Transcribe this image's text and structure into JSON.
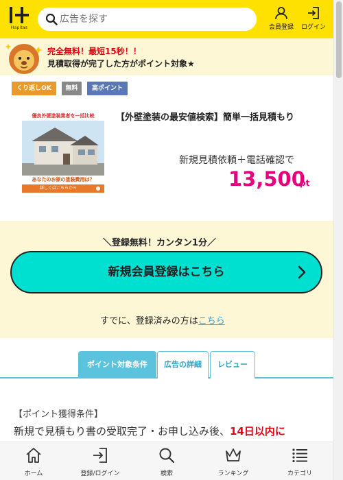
{
  "header": {
    "logo_text": "Hapitas",
    "search": {
      "placeholder": "広告を探す"
    },
    "register_label": "会員登録",
    "login_label": "ログイン"
  },
  "promo": {
    "line1": "完全無料！最短15秒！！",
    "line2": "見積取得が完了した方がポイント対象★"
  },
  "tags": [
    "くり返しOK",
    "無料",
    "高ポイント"
  ],
  "ad": {
    "image_top": "優良外壁塗装業者を一括比較",
    "image_bottom": "あなたのお家の塗装費用は？",
    "image_button": "詳しくはこちらから",
    "title": "【外壁塗装の最安値検索】簡単一括見積もり",
    "condition": "新規見積依頼＋電話確認で",
    "points": "13,500",
    "unit": "pt"
  },
  "register": {
    "catch": "＼登録無料！カンタン1分／",
    "button_label": "新規会員登録はこちら",
    "already_text": "すでに、登録済みの方は",
    "already_link": "こちら"
  },
  "tabs": [
    {
      "label": "ポイント対象条件",
      "active": true
    },
    {
      "label": "広告の詳細",
      "active": false
    },
    {
      "label": "レビュー",
      "active": false
    }
  ],
  "conditions": {
    "label": "【ポイント獲得条件】",
    "text": "新規で見積もり書の受取完了・お申し込み後、",
    "highlight": "14日以内に"
  },
  "bottom_nav": [
    {
      "label": "ホーム",
      "icon": "home-icon"
    },
    {
      "label": "登録/ログイン",
      "icon": "login-icon"
    },
    {
      "label": "検索",
      "icon": "search-icon"
    },
    {
      "label": "ランキング",
      "icon": "crown-icon"
    },
    {
      "label": "カテゴリ",
      "icon": "list-icon"
    }
  ],
  "colors": {
    "header_bg": "#ffe100",
    "promo_bg": "#fdf7d6",
    "accent_red": "#e60012",
    "points": "#e4007f",
    "register_button": "#00e0d0",
    "tab_accent": "#5cc3df"
  }
}
